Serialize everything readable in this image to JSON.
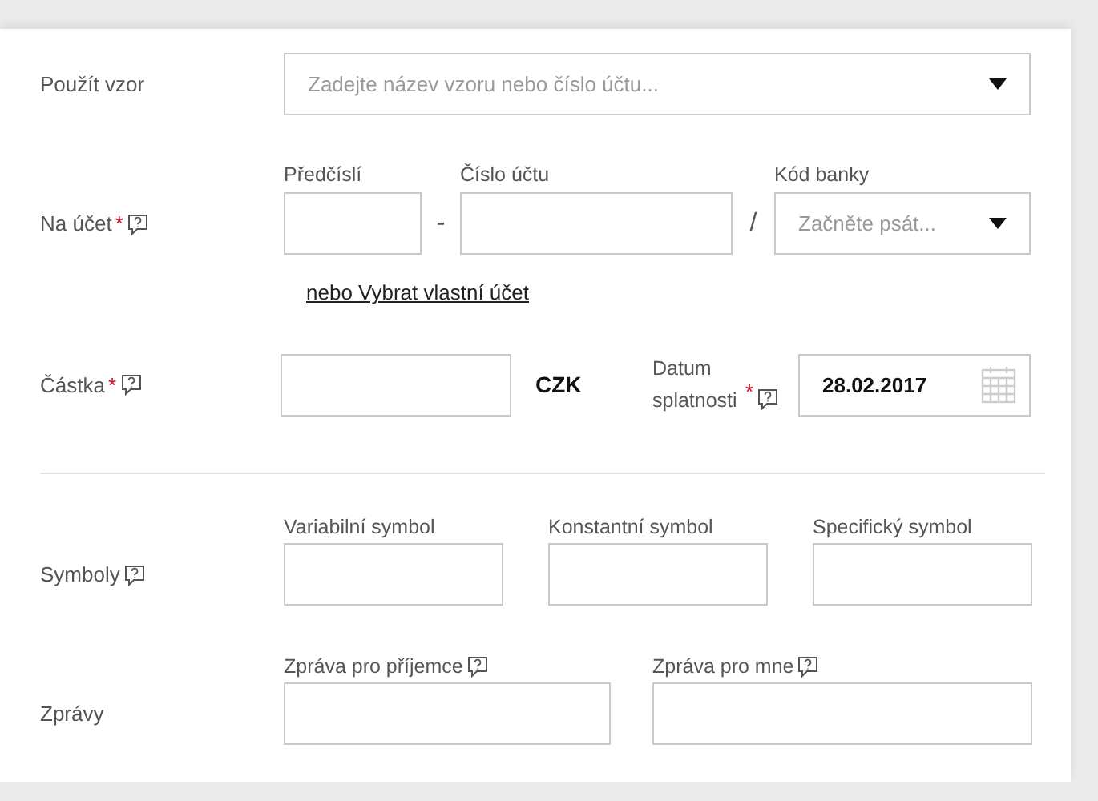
{
  "template": {
    "label": "Použít vzor",
    "help": false,
    "placeholder": "Zadejte název vzoru nebo číslo účtu..."
  },
  "account": {
    "label": "Na účet",
    "required_mark": "*",
    "help": true,
    "prefix": {
      "label": "Předčíslí"
    },
    "separator_1": "-",
    "number": {
      "label": "Číslo účtu"
    },
    "separator_2": "/",
    "bank": {
      "label": "Kód banky",
      "placeholder": "Začněte psát..."
    },
    "link": "nebo Vybrat vlastní účet"
  },
  "amount": {
    "label": "Částka",
    "required_mark": "*",
    "help": true,
    "currency": "CZK",
    "due_date": {
      "label": "Datum splatnosti",
      "required_mark": "*",
      "help": true,
      "value": "28.02.2017"
    }
  },
  "symbols": {
    "label": "Symboly",
    "help": true,
    "fields": [
      {
        "label": "Variabilní symbol",
        "help": false
      },
      {
        "label": "Konstantní symbol",
        "help": false
      },
      {
        "label": "Specifický symbol",
        "help": false
      }
    ]
  },
  "messages": {
    "label": "Zprávy",
    "help": false,
    "fields": [
      {
        "label": "Zpráva pro příjemce",
        "help": true
      },
      {
        "label": "Zpráva pro mne",
        "help": true
      }
    ]
  }
}
